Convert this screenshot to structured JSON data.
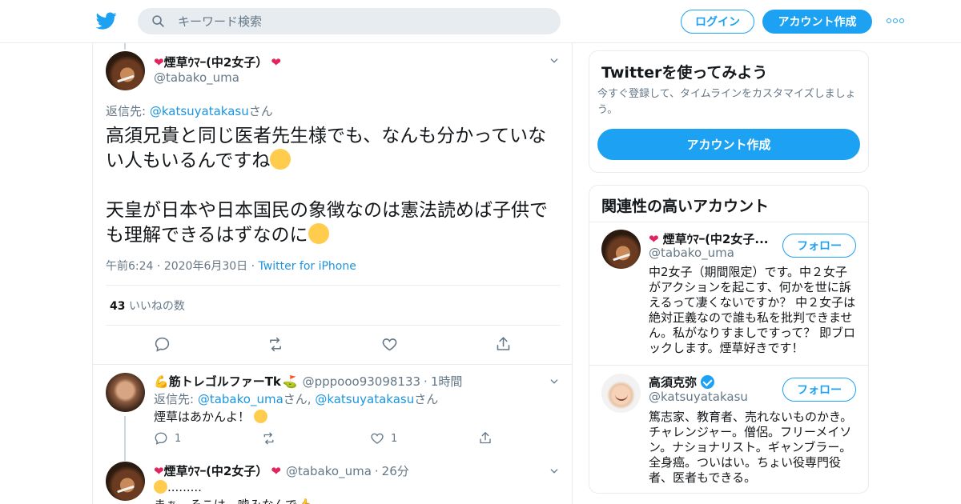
{
  "header": {
    "search_placeholder": "キーワード検索",
    "login_label": "ログイン",
    "signup_label": "アカウント作成"
  },
  "focus_tweet": {
    "display_name": "煙草ｳﾏｰ(中2女子）",
    "handle": "@tabako_uma",
    "reply_prefix": "返信先: ",
    "reply_to": "@katsuyatakasu",
    "reply_suffix": "さん",
    "paragraph_1": "高須兄貴と同じ医者先生様でも、なんも分かっていない人もいるんですね",
    "paragraph_2": "天皇が日本や日本国民の象徴なのは憲法読めば子供でも理解できるはずなのに",
    "time": "午前6:24",
    "date": "2020年6月30日",
    "source": "Twitter for iPhone",
    "likes_count": "43",
    "likes_label": "いいねの数"
  },
  "replies": [
    {
      "display_name": "筋トレゴルファーTk",
      "handle": "@pppooo93098133",
      "time": "1時間",
      "reply_prefix": "返信先: ",
      "reply_to_1": "@tabako_uma",
      "reply_mid": "さん, ",
      "reply_to_2": "@katsuyatakasu",
      "reply_suffix": "さん",
      "text": "煙草はあかんよ！",
      "reply_count": "1",
      "like_count": "1"
    },
    {
      "display_name": "煙草ｳﾏｰ(中2女子）",
      "handle": "@tabako_uma",
      "time": "26分",
      "text_1": ".........",
      "text_2": "まぁ、そこは、噛みなんで"
    }
  ],
  "sidebar": {
    "signup_card": {
      "title": "Twitterを使ってみよう",
      "subtitle": "今すぐ登録して、タイムラインをカスタマイズしましょう。",
      "cta_label": "アカウント作成"
    },
    "related": {
      "title": "関連性の高いアカウント",
      "follow_label": "フォロー",
      "accounts": [
        {
          "display_name": "煙草ｳﾏｰ(中2女子...",
          "handle": "@tabako_uma",
          "bio": "中2女子（期間限定）です。中２女子がアクションを起こす、何かを世に訴えるって凄くないですか？ 中２女子は絶対正義なので誰も私を批判できません。私がなりすましですって？ 即ブロックします。煙草好きです！"
        },
        {
          "display_name": "高須克弥",
          "handle": "@katsuyatakasu",
          "bio": "篤志家、教育者、売れないものかき。チャレンジャー。僧侶。フリーメイソン。ナショナリスト。ギャンブラー。全身癌。ついはい。ちょい役専門役者、医者もできる。"
        }
      ]
    }
  },
  "colors": {
    "accent": "#1da1f2",
    "link": "#1b95e0",
    "heart": "#e0245e",
    "secondary_text": "#657786"
  }
}
